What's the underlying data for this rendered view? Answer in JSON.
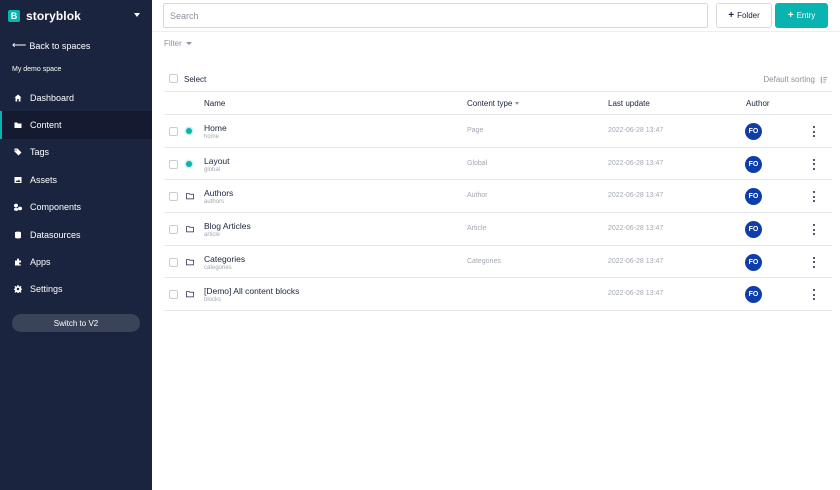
{
  "brand": {
    "logo_letter": "B",
    "name": "storyblok"
  },
  "sidebar": {
    "back_label": "Back to spaces",
    "space_name": "My demo space",
    "items": [
      {
        "label": "Dashboard",
        "icon": "home-icon"
      },
      {
        "label": "Content",
        "icon": "folder-icon",
        "active": true
      },
      {
        "label": "Tags",
        "icon": "tags-icon"
      },
      {
        "label": "Assets",
        "icon": "image-icon"
      },
      {
        "label": "Components",
        "icon": "components-icon"
      },
      {
        "label": "Datasources",
        "icon": "database-icon"
      },
      {
        "label": "Apps",
        "icon": "puzzle-icon"
      },
      {
        "label": "Settings",
        "icon": "gear-icon"
      }
    ],
    "switch_label": "Switch to V2"
  },
  "toolbar": {
    "search_placeholder": "Search",
    "folder_label": "Folder",
    "entry_label": "Entry"
  },
  "filter_label": "Filter",
  "list": {
    "select_label": "Select",
    "sort_label": "Default sorting",
    "columns": {
      "name": "Name",
      "content_type": "Content type",
      "last_update": "Last update",
      "author": "Author"
    },
    "rows": [
      {
        "name": "Home",
        "slug": "home",
        "content_type": "Page",
        "last_update": "2022-06-28 13:47",
        "author": "FO",
        "kind": "story"
      },
      {
        "name": "Layout",
        "slug": "global",
        "content_type": "Global",
        "last_update": "2022-06-28 13:47",
        "author": "FO",
        "kind": "story"
      },
      {
        "name": "Authors",
        "slug": "authors",
        "content_type": "Author",
        "last_update": "2022-06-28 13:47",
        "author": "FO",
        "kind": "folder"
      },
      {
        "name": "Blog Articles",
        "slug": "article",
        "content_type": "Article",
        "last_update": "2022-06-28 13:47",
        "author": "FO",
        "kind": "folder"
      },
      {
        "name": "Categories",
        "slug": "categories",
        "content_type": "Categories",
        "last_update": "2022-06-28 13:47",
        "author": "FO",
        "kind": "folder"
      },
      {
        "name": "[Demo] All content blocks",
        "slug": "blocks",
        "content_type": "",
        "last_update": "2022-06-28 13:47",
        "author": "FO",
        "kind": "folder"
      }
    ]
  },
  "colors": {
    "sidebar_bg": "#1b243f",
    "accent": "#09b3af",
    "avatar": "#0f3ea8"
  }
}
